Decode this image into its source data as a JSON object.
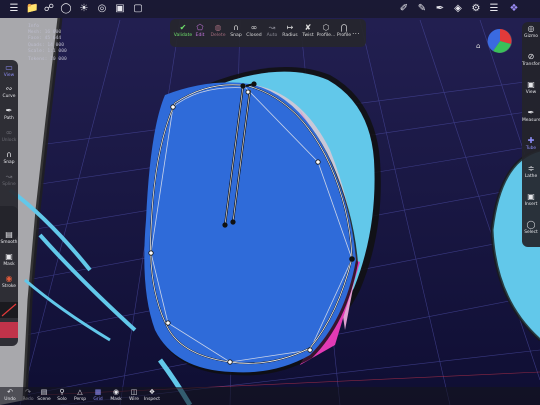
{
  "info_overlay": {
    "lines": [
      "Info",
      "Mesh: 16 000",
      "Face: 45 644",
      "Quads: 14 000",
      "Scale: 1:1 000"
    ],
    "subtitle": "Tokens: 10 000"
  },
  "top_bar": {
    "icons": [
      "menu-icon",
      "folder-icon",
      "share-icon",
      "globe-icon",
      "sun-icon",
      "target-icon",
      "image-icon",
      "video-icon"
    ],
    "right_icons": [
      "brush-icon",
      "pencil-icon",
      "eyedropper-icon",
      "layers-icon",
      "gear-icon",
      "settings-icon",
      "sculpt-app-icon"
    ]
  },
  "curve_palette": {
    "items": [
      {
        "id": "validate",
        "label": "Validate",
        "icon": "checkmark"
      },
      {
        "id": "edit",
        "label": "Edit",
        "icon": "edit-polygon"
      },
      {
        "id": "delete",
        "label": "Delete",
        "icon": "delete"
      },
      {
        "id": "snap",
        "label": "Snap",
        "icon": "magnet"
      },
      {
        "id": "closed",
        "label": "Closed",
        "icon": "closed-loop"
      },
      {
        "id": "auto",
        "label": "Auto",
        "icon": "auto"
      },
      {
        "id": "radius",
        "label": "Radius",
        "icon": "radius"
      },
      {
        "id": "twist",
        "label": "Twist",
        "icon": "twist"
      },
      {
        "id": "profile",
        "label": "Profile...",
        "icon": "profile"
      },
      {
        "id": "fallof",
        "label": "Profile",
        "icon": "falloff"
      }
    ],
    "more_label": "..."
  },
  "left_toolbar": {
    "tools": [
      {
        "id": "view",
        "label": "View",
        "active": true
      },
      {
        "id": "curve",
        "label": "Curve",
        "active": false
      },
      {
        "id": "path",
        "label": "Path",
        "active": false
      },
      {
        "id": "unlock",
        "label": "Unlock",
        "active": false,
        "dim": true
      },
      {
        "id": "snap",
        "label": "Snap",
        "active": false
      },
      {
        "id": "spline",
        "label": "Spline",
        "active": false,
        "dim": true
      }
    ]
  },
  "left_toolbar_lower": {
    "tools": [
      {
        "id": "smooth",
        "label": "Smooth"
      },
      {
        "id": "mask",
        "label": "Mask"
      },
      {
        "id": "stroke",
        "label": "Stroke"
      }
    ]
  },
  "right_toolbar": {
    "tools": [
      {
        "id": "gizmo",
        "label": "Gizmo"
      },
      {
        "id": "transform",
        "label": "Transform"
      },
      {
        "id": "view",
        "label": "View"
      },
      {
        "id": "measure",
        "label": "Measure"
      },
      {
        "id": "tube",
        "label": "Tube",
        "active": true
      },
      {
        "id": "lathe",
        "label": "Lathe"
      },
      {
        "id": "insert",
        "label": "Insert"
      },
      {
        "id": "select",
        "label": "Select"
      }
    ]
  },
  "bottom_bar": {
    "left_buttons": [
      {
        "id": "undo",
        "label": "Undo"
      },
      {
        "id": "redo",
        "label": "Redo"
      }
    ],
    "buttons": [
      {
        "id": "scene",
        "label": "Scene"
      },
      {
        "id": "solo",
        "label": "Solo"
      },
      {
        "id": "persp",
        "label": "Persp"
      },
      {
        "id": "grid",
        "label": "Grid",
        "active": true
      },
      {
        "id": "mask",
        "label": "Mask"
      },
      {
        "id": "wire",
        "label": "Wire"
      },
      {
        "id": "inspect",
        "label": "Inspect"
      }
    ]
  },
  "colors": {
    "background": "#1a1744",
    "object_blue": "#2f6bd9",
    "object_cyan": "#62c8ea",
    "accent_purple": "#8d8df6",
    "validate_green": "#6ee06a",
    "highlight_pink": "#e23ab5"
  }
}
